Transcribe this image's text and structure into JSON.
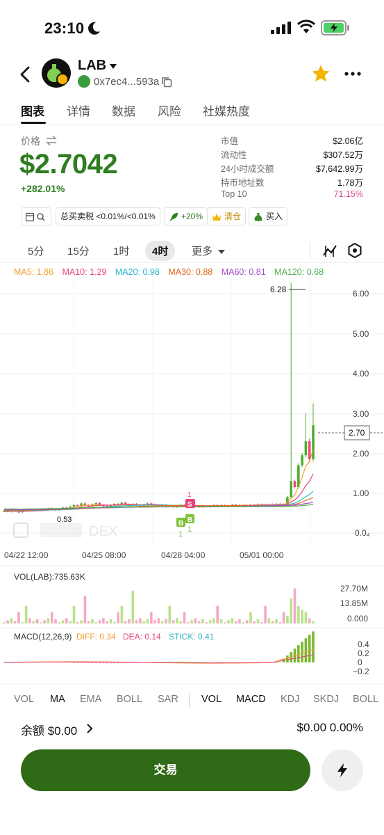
{
  "status": {
    "time": "23:10"
  },
  "header": {
    "token": "LAB",
    "address": "0x7ec4...593a"
  },
  "tabs": [
    {
      "label": "图表"
    },
    {
      "label": "详情"
    },
    {
      "label": "数据"
    },
    {
      "label": "风险"
    },
    {
      "label": "社媒热度"
    }
  ],
  "price_panel": {
    "label": "价格",
    "price": "$2.7042",
    "change": "+282.01%"
  },
  "stats": [
    {
      "label": "市值",
      "value": "$2.06亿"
    },
    {
      "label": "流动性",
      "value": "$307.52万"
    },
    {
      "label": "24小时成交额",
      "value": "$7,642.99万"
    },
    {
      "label": "持币地址数",
      "value": "1.78万"
    },
    {
      "label": "Top 10",
      "value": "71.15%"
    }
  ],
  "chips": {
    "tax": "总买卖税",
    "tax_value": "<0.01%/<0.01%",
    "boost": "+20%",
    "clear": "清仓",
    "buy": "买入"
  },
  "intervals": [
    {
      "label": "5分"
    },
    {
      "label": "15分"
    },
    {
      "label": "1时"
    },
    {
      "label": "4时"
    },
    {
      "label": "更多"
    }
  ],
  "ma_legend": [
    {
      "text": "MA5: 1.86",
      "color": "#f0a030"
    },
    {
      "text": "MA10: 1.29",
      "color": "#e8447a"
    },
    {
      "text": "MA20: 0.98",
      "color": "#2bb5c8"
    },
    {
      "text": "MA30: 0.88",
      "color": "#e8661e"
    },
    {
      "text": "MA60: 0.81",
      "color": "#a64dc8"
    },
    {
      "text": "MA120: 0.68",
      "color": "#4fae4f"
    }
  ],
  "chart": {
    "y_ticks": [
      "6.00",
      "5.00",
      "4.00",
      "3.00",
      "2.00",
      "1.00",
      "0.0₄"
    ],
    "high_label": "6.28",
    "low_label": "0.53",
    "current_label": "2.70",
    "x_ticks": [
      "04/22 12:00",
      "04/25 08:00",
      "04/28 04:00",
      "05/01 00:00"
    ],
    "watermark": "DEX",
    "vol_label": "VOL(LAB):735.63K",
    "vol_ticks": [
      "27.70M",
      "13.85M",
      "0.000"
    ],
    "macd_label": "MACD(12,26,9)",
    "diff": "DIFF: 0.34",
    "dea": "DEA: 0.14",
    "stick": "STICK: 0.41",
    "macd_ticks": [
      "0.4",
      "0.2",
      "0",
      "−0.2"
    ],
    "marker_s": "S",
    "marker_b": "B",
    "marker_one": "1"
  },
  "chart_data": {
    "type": "candlestick",
    "x_ticks": [
      "04/22 12:00",
      "04/25 08:00",
      "04/28 04:00",
      "05/01 00:00"
    ],
    "ylim": [
      0,
      6.5
    ],
    "high": 6.28,
    "current": 2.7,
    "closes": [
      0.55,
      0.53,
      0.56,
      0.54,
      0.52,
      0.55,
      0.57,
      0.55,
      0.58,
      0.56,
      0.6,
      0.58,
      0.62,
      0.6,
      0.57,
      0.6,
      0.64,
      0.62,
      0.66,
      0.7,
      0.68,
      0.74,
      0.7,
      0.67,
      0.72,
      0.75,
      0.7,
      0.68,
      0.66,
      0.7,
      0.73,
      0.71,
      0.76,
      0.72,
      0.69,
      0.73,
      0.7,
      0.68,
      0.71,
      0.74,
      0.72,
      0.7,
      0.68,
      0.7,
      0.66,
      0.68,
      0.65,
      0.67,
      0.7,
      0.69,
      0.66,
      0.68,
      0.67,
      0.65,
      0.68,
      0.66,
      0.69,
      0.7,
      0.68,
      0.7,
      0.67,
      0.69,
      0.71,
      0.7,
      0.68,
      0.7,
      0.69,
      0.71,
      0.7,
      0.72,
      0.71,
      0.7,
      0.72,
      0.71,
      0.73,
      0.72,
      0.7,
      0.9,
      1.3,
      1.15,
      1.7,
      1.95,
      2.3,
      1.85,
      2.7
    ]
  },
  "bottom_tabs": [
    {
      "label": "VOL"
    },
    {
      "label": "MA"
    },
    {
      "label": "EMA"
    },
    {
      "label": "BOLL"
    },
    {
      "label": "SAR"
    },
    {
      "label": "VOL"
    },
    {
      "label": "MACD"
    },
    {
      "label": "KDJ"
    },
    {
      "label": "SKDJ"
    },
    {
      "label": "BOLL"
    }
  ],
  "balance": {
    "left": "余额 $0.00",
    "right": "$0.00 0.00%"
  },
  "trade_label": "交易",
  "colors": {
    "up": "#4cae2f",
    "down": "#ea4b7a",
    "accent": "#2f6b17"
  }
}
